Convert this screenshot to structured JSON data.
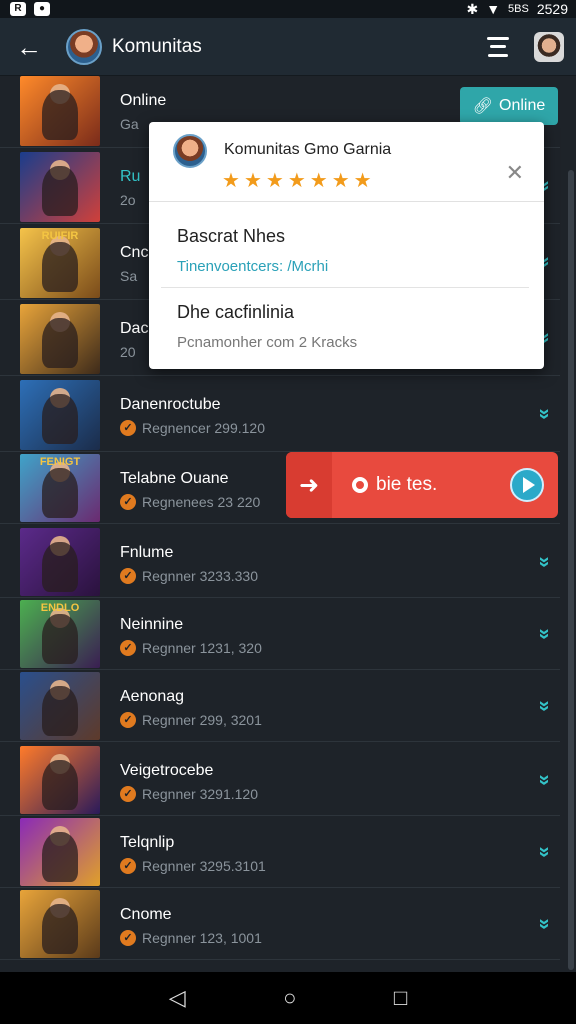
{
  "statusbar": {
    "left_icons": [
      "R",
      "●"
    ],
    "signal_text": "5BS",
    "time": "2529"
  },
  "appbar": {
    "title": "Komunitas"
  },
  "online_button": {
    "label": "Online"
  },
  "popup": {
    "title": "Komunitas Gmo Garnia",
    "stars": [
      "★",
      "★",
      "★",
      "★",
      "★",
      "★",
      "★"
    ],
    "items": [
      {
        "title": "Bascrat Nhes",
        "subtitle": "Tinenvoentcers: /Mcrhi",
        "subtitle_color": "#2aa1b8"
      },
      {
        "title": "Dhe cacfinlinia",
        "subtitle": "Pcnamonher com 2 Kracks",
        "subtitle_color": "#777777"
      }
    ]
  },
  "action_bar": {
    "label": "bie tes."
  },
  "rows": [
    {
      "name": "Online",
      "meta": "Ga",
      "thumb": [
        "#ff8a2a",
        "#7a2b1a"
      ],
      "banner": ""
    },
    {
      "name": "Ru",
      "meta": "2o",
      "thumb": [
        "#1a3d8c",
        "#d0403a"
      ],
      "banner": "",
      "name_color": "#33c3c8"
    },
    {
      "name": "Cnc",
      "meta": "Sa",
      "thumb": [
        "#f5c34a",
        "#7a4b1a"
      ],
      "banner": "RUIFIR"
    },
    {
      "name": "Dac",
      "meta": "20",
      "thumb": [
        "#e8a43a",
        "#3d2a1a"
      ],
      "banner": ""
    },
    {
      "name": "Danenroctube",
      "meta": "Regnencer 299.120",
      "thumb": [
        "#2d6fb7",
        "#1b2c4a"
      ],
      "banner": ""
    },
    {
      "name": "Telabne Ouane",
      "meta": "Regnenees 23 220",
      "thumb": [
        "#3fa3c9",
        "#6b2a70"
      ],
      "banner": "FENIGT"
    },
    {
      "name": "Fnlume",
      "meta": "Regnner 3233.330",
      "thumb": [
        "#5b2a8a",
        "#2a123d"
      ],
      "banner": ""
    },
    {
      "name": "Neinnine",
      "meta": "Regnner 1231, 320",
      "thumb": [
        "#4caf50",
        "#3a1e52"
      ],
      "banner": "ENDLO"
    },
    {
      "name": "Aenonag",
      "meta": "Regnner 299, 3201",
      "thumb": [
        "#2a4f8c",
        "#5e3a2a"
      ],
      "banner": ""
    },
    {
      "name": "Veigetrocebe",
      "meta": "Regnner 3291.120",
      "thumb": [
        "#ff7b2a",
        "#2a1a5a"
      ],
      "banner": ""
    },
    {
      "name": "Telqnlip",
      "meta": "Regnner 3295.3101",
      "thumb": [
        "#8a2ab7",
        "#e0a02a"
      ],
      "banner": ""
    },
    {
      "name": "Cnome",
      "meta": "Regnner 123, 1001",
      "thumb": [
        "#e8a43a",
        "#5a3a1a"
      ],
      "banner": ""
    }
  ]
}
